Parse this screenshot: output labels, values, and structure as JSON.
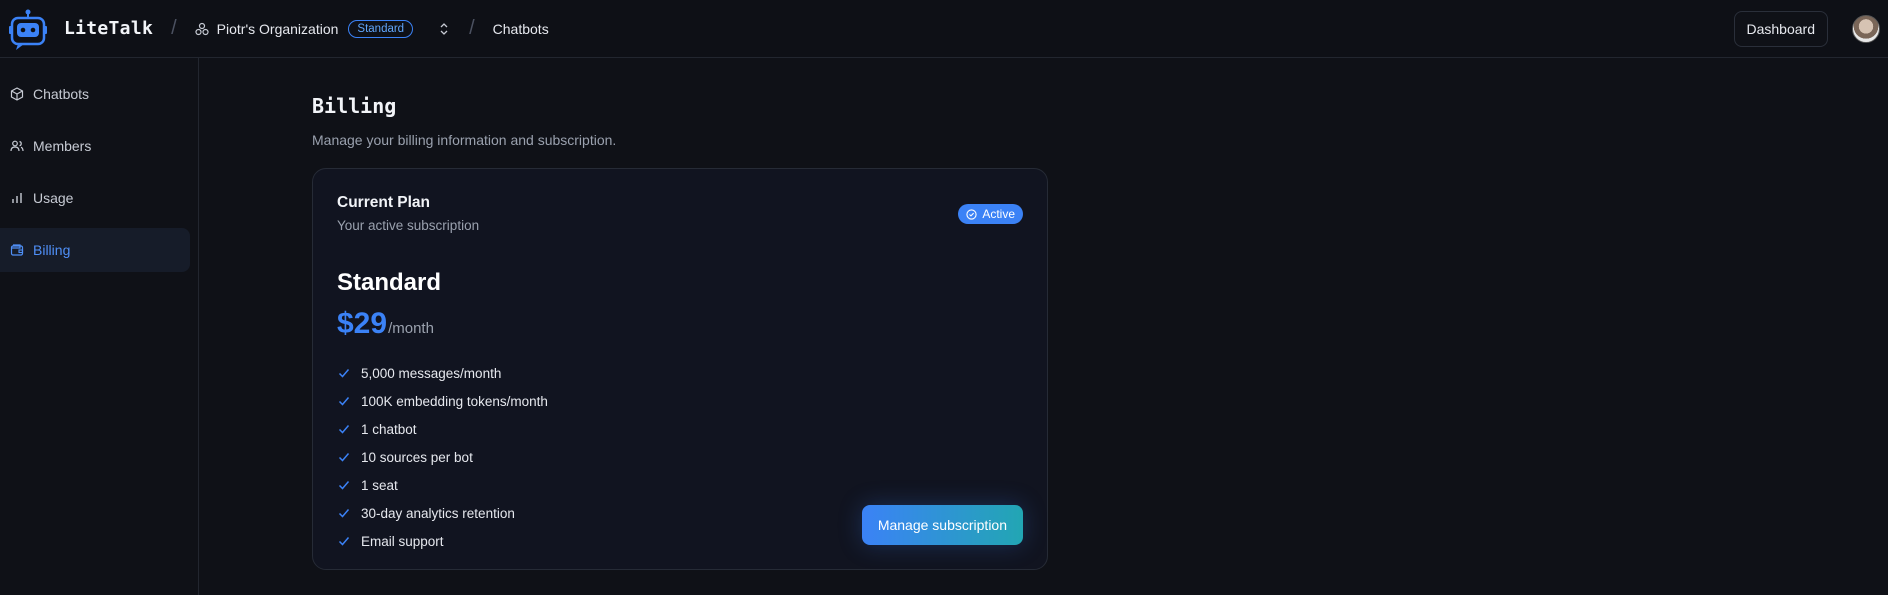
{
  "app": {
    "brand": "LiteTalk"
  },
  "header": {
    "organization": "Piotr's Organization",
    "plan_badge": "Standard",
    "breadcrumb_current": "Chatbots",
    "dashboard_label": "Dashboard"
  },
  "sidebar": {
    "items": [
      {
        "label": "Chatbots",
        "icon": "cube-icon"
      },
      {
        "label": "Members",
        "icon": "users-icon"
      },
      {
        "label": "Usage",
        "icon": "bar-chart-icon"
      },
      {
        "label": "Billing",
        "icon": "wallet-icon",
        "active": true
      }
    ]
  },
  "page": {
    "title": "Billing",
    "subtitle": "Manage your billing information and subscription."
  },
  "plan_card": {
    "title": "Current Plan",
    "subtitle": "Your active subscription",
    "status": "Active",
    "plan_name": "Standard",
    "price": "$29",
    "price_unit": "/month",
    "features": [
      "5,000 messages/month",
      "100K embedding tokens/month",
      "1 chatbot",
      "10 sources per bot",
      "1 seat",
      "30-day analytics retention",
      "Email support"
    ],
    "manage_label": "Manage subscription"
  },
  "colors": {
    "accent": "#3b82f6",
    "background": "#0f1117",
    "card": "#111420"
  }
}
